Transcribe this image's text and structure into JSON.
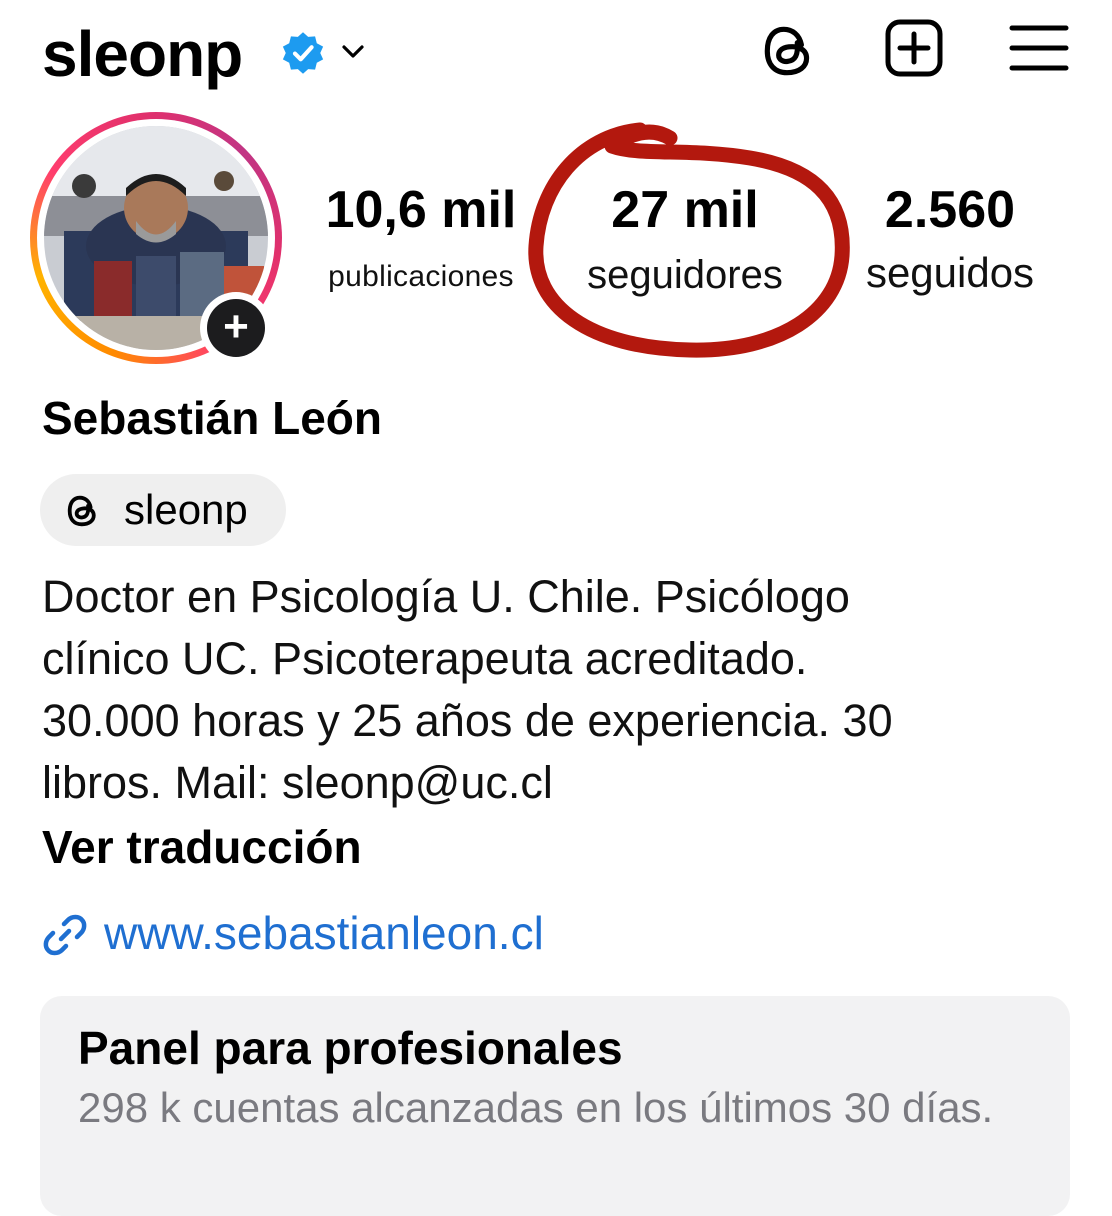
{
  "header": {
    "username": "sleonp",
    "verified": true,
    "icons": [
      "verified-badge-icon",
      "chevron-down-icon",
      "threads-icon",
      "create-post-icon",
      "menu-icon"
    ]
  },
  "profile": {
    "full_name": "Sebastián León",
    "threads_handle": "sleonp",
    "stats": {
      "posts": {
        "count": "10,6 mil",
        "label": "publicaciones"
      },
      "followers": {
        "count": "27 mil",
        "label": "seguidores"
      },
      "following": {
        "count": "2.560",
        "label": "seguidos"
      }
    },
    "bio_lines": [
      "Doctor en Psicología U. Chile. Psicólogo",
      "clínico UC. Psicoterapeuta acreditado.",
      "30.000 horas y 25 años de experiencia. 30",
      "libros. Mail: sleonp@uc.cl"
    ],
    "translate_label": "Ver traducción",
    "website": "www.sebastianleon.cl"
  },
  "panel": {
    "title": "Panel para profesionales",
    "subtitle": "298 k cuentas alcanzadas en los últimos 30 días."
  },
  "colors": {
    "verified_blue": "#1d9bf0",
    "link_blue": "#1f6fd1",
    "annotation_red": "#b3180e",
    "panel_bg": "#f2f2f3"
  }
}
